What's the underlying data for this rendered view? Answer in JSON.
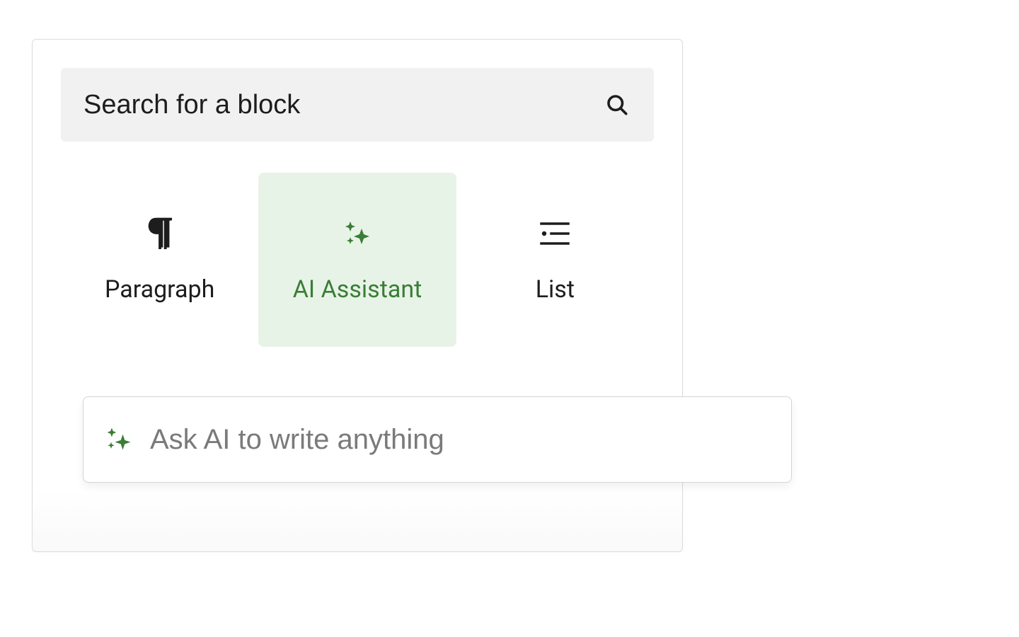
{
  "search": {
    "placeholder": "Search for a block"
  },
  "blocks": [
    {
      "label": "Paragraph",
      "selected": false
    },
    {
      "label": "AI Assistant",
      "selected": true
    },
    {
      "label": "List",
      "selected": false
    }
  ],
  "ai_prompt": {
    "placeholder": "Ask AI to write anything"
  },
  "colors": {
    "accent_green": "#3a7d36",
    "panel_bg": "#ffffff",
    "selected_bg": "#e8f3e7"
  }
}
